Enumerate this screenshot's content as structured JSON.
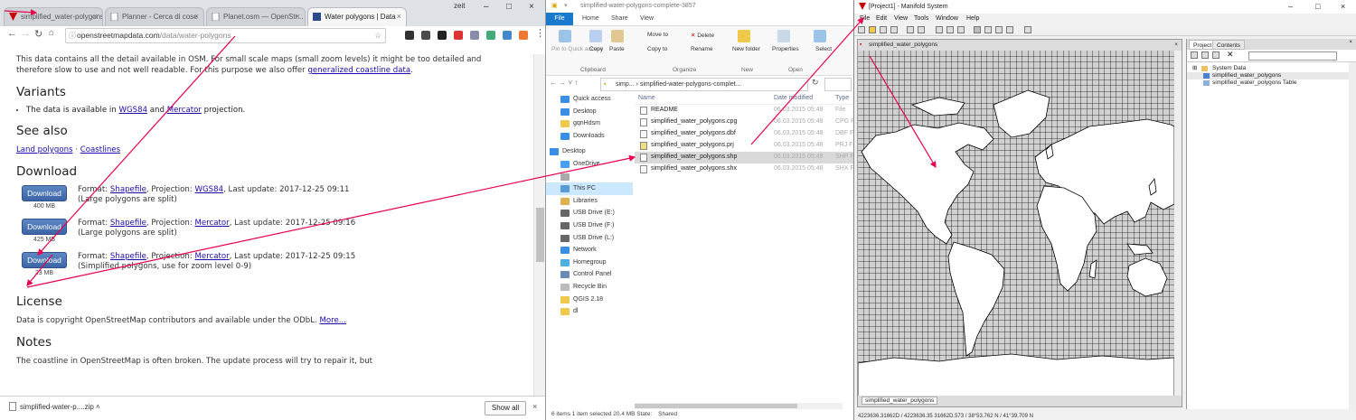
{
  "chrome": {
    "tabs": [
      {
        "label": "simplified_water-polygons.zip"
      },
      {
        "label": "Planner - Cerca di cose"
      },
      {
        "label": "Planet.osm — OpenStr..."
      },
      {
        "label": "Water polygons | Data"
      }
    ],
    "user": "zeit",
    "url_host": "openstreetmapdata.com",
    "url_path": "/data/water-polygons",
    "intro": "This data contains all the detail available in OSM. For small scale maps (small zoom levels) it might be too detailed and therefore slow to use and not well readable. For this purpose we also offer",
    "intro_link": "generalized coastline data",
    "variants_heading": "Variants",
    "variants_text": "The data is available in",
    "variants_link1": "WGS84",
    "variants_and": "and",
    "variants_link2": "Mercator",
    "variants_tail": "projection.",
    "seealso_heading": "See also",
    "seealso_link1": "Land polygons",
    "seealso_sep": "·",
    "seealso_link2": "Coastlines",
    "download_heading": "Download",
    "downloads": [
      {
        "button": "Download",
        "size": "400 MB",
        "format_label": "Format:",
        "format": "Shapefile",
        "proj_label": ", Projection:",
        "proj": "WGS84",
        "update": ", Last update: 2017-12-25 09:11",
        "note": "(Large polygons are split)"
      },
      {
        "button": "Download",
        "size": "425 MB",
        "format_label": "Format:",
        "format": "Shapefile",
        "proj_label": ", Projection:",
        "proj": "Mercator",
        "update": ", Last update: 2017-12-25 09:16",
        "note": "(Large polygons are split)"
      },
      {
        "button": "Download",
        "size": "23 MB",
        "format_label": "Format:",
        "format": "Shapefile",
        "proj_label": ", Projection:",
        "proj": "Mercator",
        "update": ", Last update: 2017-12-25 09:15",
        "note": "(Simplified polygons, use for zoom level 0-9)"
      }
    ],
    "license_heading": "License",
    "license_text": "Data is copyright OpenStreetMap contributors and available under the ODbL.",
    "license_link": "More...",
    "notes_heading": "Notes",
    "notes_text": "The coastline in OpenStreetMap is often broken. The update process will try to repair it, but",
    "download_file": "simplified-water-p....zip",
    "show_all": "Show all"
  },
  "explorer": {
    "title": "simplified-water-polygons-complete-3857",
    "ribbon_tabs": [
      "File",
      "Home",
      "Share",
      "View"
    ],
    "ribbon": {
      "pin": "Pin to Quick access",
      "copy": "Copy",
      "paste": "Paste",
      "move_to": "Move to",
      "copy_to": "Copy to",
      "delete": "Delete",
      "rename": "Rename",
      "new_folder": "New folder",
      "properties": "Properties",
      "select": "Select",
      "grp_clipboard": "Clipboard",
      "grp_organize": "Organize",
      "grp_new": "New",
      "grp_open": "Open"
    },
    "address": "simp... › simplified-water-polygons-complet...",
    "nav": [
      "Quick access",
      "Desktop",
      "gqnHdsm",
      "Downloads",
      "Desktop",
      "OneDrive",
      "",
      "This PC",
      "Libraries",
      "USB Drive (E:)",
      "USB Drive (F:)",
      "USB Drive (L:)",
      "Network",
      "Homegroup",
      "Control Panel",
      "Recycle Bin",
      "QGIS 2.18",
      "dl"
    ],
    "columns": [
      "Name",
      "Date modified",
      "Type"
    ],
    "files": [
      {
        "name": "README",
        "date": "06.03.2015 05:48",
        "type": "File"
      },
      {
        "name": "simplified_water_polygons.cpg",
        "date": "06.03.2015 05:48",
        "type": "CPG File"
      },
      {
        "name": "simplified_water_polygons.dbf",
        "date": "06.03.2015 05:48",
        "type": "DBF File"
      },
      {
        "name": "simplified_water_polygons.prj",
        "date": "06.03.2015 05:48",
        "type": "PRJ File"
      },
      {
        "name": "simplified_water_polygons.shp",
        "date": "06.03.2015 05:48",
        "type": "SHP File"
      },
      {
        "name": "simplified_water_polygons.shx",
        "date": "06.03.2015 05:48",
        "type": "SHX File"
      }
    ],
    "status": "6 items     1 item selected  20.4 MB          State:   Shared"
  },
  "manifold": {
    "title": "[Project1] - Manifold System",
    "menu": [
      "File",
      "Edit",
      "View",
      "Tools",
      "Window",
      "Help"
    ],
    "map_tab": "simplified_water_polygons",
    "map_bottom_tab": "simplified_water_polygons",
    "panel_tabs": [
      "Project",
      "Contents"
    ],
    "tree": [
      "System Data",
      "simplified_water_polygons",
      "simplified_water_polygons Table"
    ],
    "status": "4223636.31662D / 4223636.35 31662D.573 / 38°53.762 N / 41°39.709 N"
  }
}
